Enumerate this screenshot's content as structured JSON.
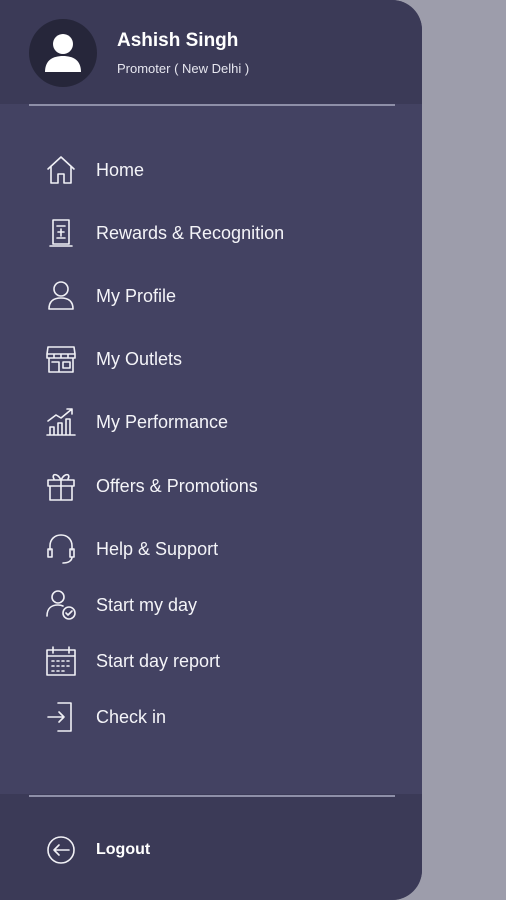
{
  "user": {
    "name": "Ashish Singh",
    "role": "Promoter ( New Delhi )"
  },
  "menu": {
    "items": [
      {
        "label": "Home",
        "icon": "home-icon"
      },
      {
        "label": "Rewards & Recognition",
        "icon": "trophy-icon"
      },
      {
        "label": "My Profile",
        "icon": "user-icon"
      },
      {
        "label": "My Outlets",
        "icon": "store-icon"
      },
      {
        "label": "My Performance",
        "icon": "chart-icon"
      },
      {
        "label": "Offers & Promotions",
        "icon": "gift-icon"
      },
      {
        "label": "Help & Support",
        "icon": "headset-icon"
      },
      {
        "label": "Start my day",
        "icon": "user-check-icon"
      },
      {
        "label": "Start day report",
        "icon": "calendar-icon"
      },
      {
        "label": "Check in",
        "icon": "check-in-icon"
      }
    ]
  },
  "footer": {
    "logout_label": "Logout"
  },
  "colors": {
    "drawer_bg": "#434262",
    "header_bg": "#3b3a57",
    "backdrop": "#9d9dab",
    "text": "#ffffff"
  }
}
